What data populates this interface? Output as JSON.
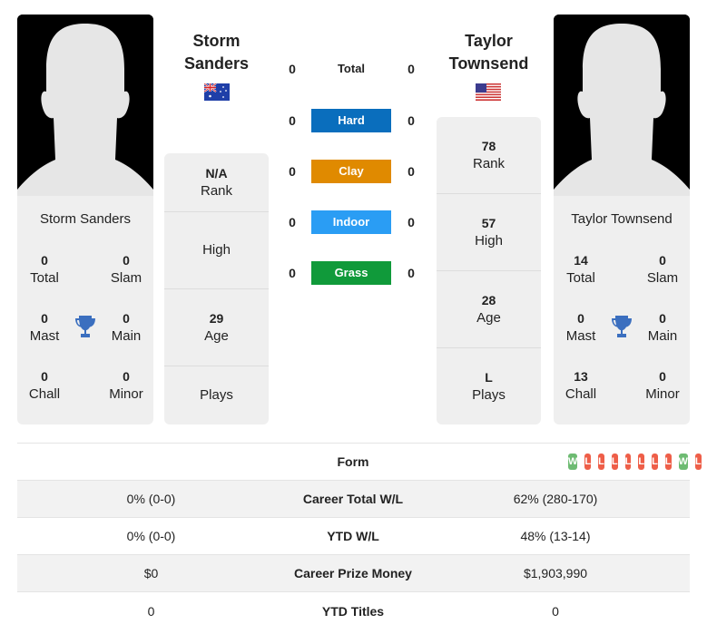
{
  "colors": {
    "hard": "#0a6ebd",
    "clay": "#e08a00",
    "indoor": "#2a9df4",
    "grass": "#109a3a",
    "win": "#6dbb72",
    "loss": "#ee5e48",
    "trophy": "#3b6fbf"
  },
  "player1": {
    "name": "Storm Sanders",
    "title_line1": "Storm",
    "title_line2": "Sanders",
    "flag": "australia-flag",
    "titles": {
      "total": "0",
      "slam": "0",
      "mast": "0",
      "main": "0",
      "chall": "0",
      "minor": "0"
    },
    "info": {
      "rank": "N/A",
      "high": "",
      "age": "29",
      "plays": ""
    }
  },
  "player2": {
    "name": "Taylor Townsend",
    "title_line1": "Taylor",
    "title_line2": "Townsend",
    "flag": "usa-flag",
    "titles": {
      "total": "14",
      "slam": "0",
      "mast": "0",
      "main": "0",
      "chall": "13",
      "minor": "0"
    },
    "info": {
      "rank": "78",
      "high": "57",
      "age": "28",
      "plays": "L"
    }
  },
  "labels": {
    "total": "Total",
    "slam": "Slam",
    "mast": "Mast",
    "main": "Main",
    "chall": "Chall",
    "minor": "Minor",
    "rank": "Rank",
    "high": "High",
    "age": "Age",
    "plays": "Plays"
  },
  "h2h": {
    "total": {
      "label": "Total",
      "p1": "0",
      "p2": "0"
    },
    "surfaces": [
      {
        "label": "Hard",
        "p1": "0",
        "p2": "0"
      },
      {
        "label": "Clay",
        "p1": "0",
        "p2": "0"
      },
      {
        "label": "Indoor",
        "p1": "0",
        "p2": "0"
      },
      {
        "label": "Grass",
        "p1": "0",
        "p2": "0"
      }
    ]
  },
  "comparison": {
    "form_label": "Form",
    "form": [
      "W",
      "L",
      "L",
      "L",
      "L",
      "L",
      "L",
      "L",
      "W",
      "L"
    ],
    "rows": [
      {
        "label": "Career Total W/L",
        "p1": "0% (0-0)",
        "p2": "62% (280-170)"
      },
      {
        "label": "YTD W/L",
        "p1": "0% (0-0)",
        "p2": "48% (13-14)"
      },
      {
        "label": "Career Prize Money",
        "p1": "$0",
        "p2": "$1,903,990"
      },
      {
        "label": "YTD Titles",
        "p1": "0",
        "p2": "0"
      }
    ]
  }
}
